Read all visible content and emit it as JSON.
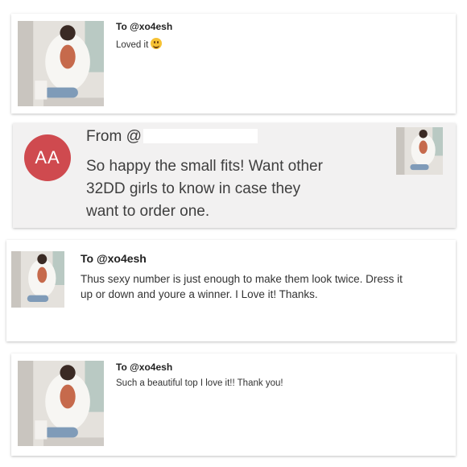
{
  "messages": [
    {
      "to_label": "To @xo4esh",
      "text": "Loved it",
      "emoji": "smiling-face-icon"
    },
    {
      "avatar_initials": "AA",
      "from_label": "From @",
      "text_lines": [
        "So happy the small fits! Want other",
        "32DD girls to know in case they",
        "want to order one."
      ]
    },
    {
      "to_label": "To @xo4esh",
      "text_lines": [
        "Thus sexy number is just enough to make them look twice. Dress it",
        "up or down and youre a winner. I Love it! Thanks."
      ]
    },
    {
      "to_label": "To @xo4esh",
      "text": "Such a beautiful top I love it!! Thank you!"
    }
  ],
  "colors": {
    "avatar_bg": "#cf4a4f",
    "card_gray": "#f2f1f1",
    "text": "#333333"
  }
}
